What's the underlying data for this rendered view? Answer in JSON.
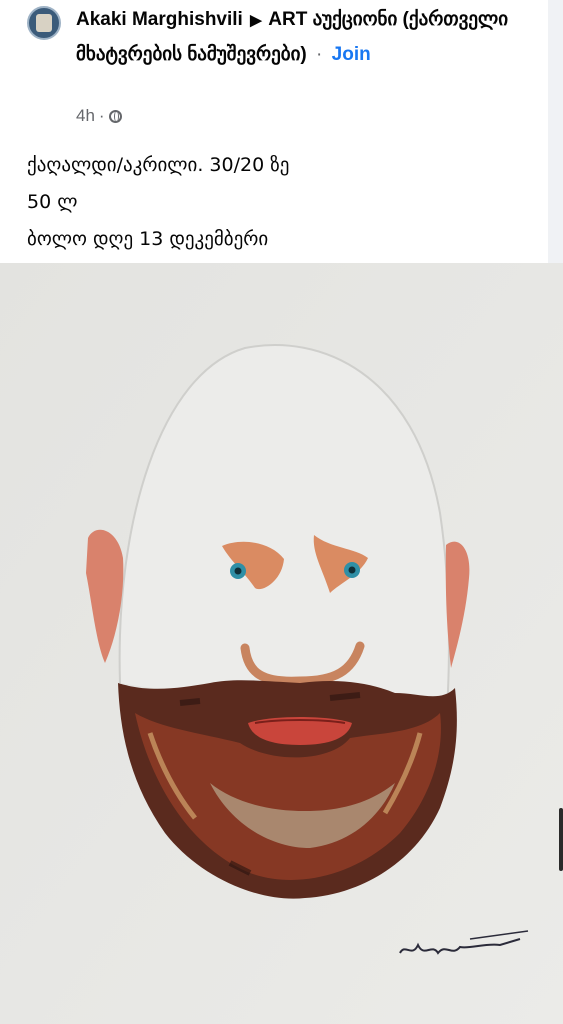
{
  "post": {
    "author": "Akaki Marghishvili",
    "arrow": "▶",
    "group": "ART აუქციონი (ქართველი მხატვრების ნამუშევრები)",
    "separator": "·",
    "join_label": "Join",
    "time": "4h",
    "time_separator": "·",
    "privacy_icon": "globe-icon",
    "body_lines": [
      "ქაღალდი/აკრილი.  30/20 ზე",
      "50 ლ",
      "ბოლო დღე  13  დეკემბერი"
    ]
  },
  "image": {
    "subject": "portrait-painting",
    "signature_text": "ა.მარღიშ",
    "colors": {
      "paper": "#e6e6e3",
      "beard_dark": "#5a2a1e",
      "beard_mid": "#8e3b26",
      "lips": "#c9453b",
      "ears": "#d9826c",
      "eyes": "#2f8fa6"
    }
  }
}
